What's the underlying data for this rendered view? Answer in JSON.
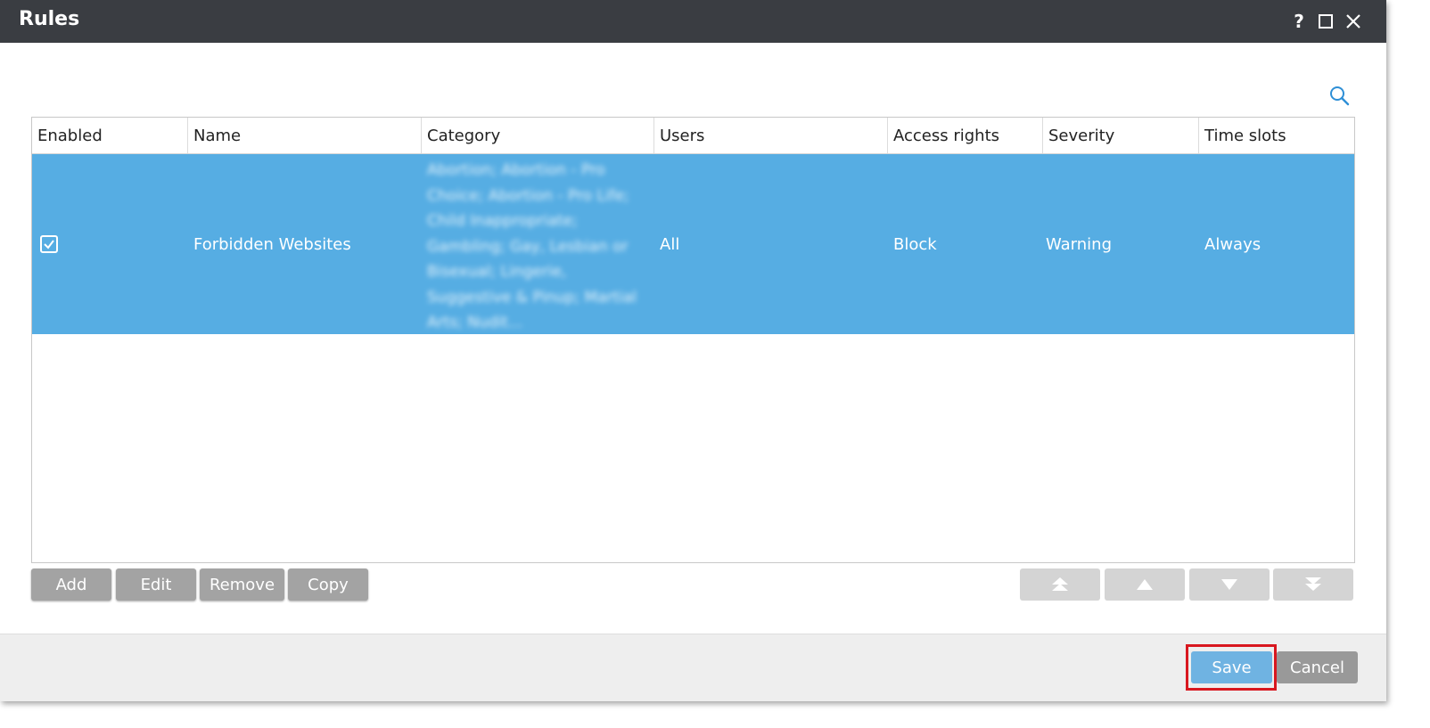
{
  "window": {
    "title": "Rules",
    "help_label": "?"
  },
  "table": {
    "columns": [
      "Enabled",
      "Name",
      "Category",
      "Users",
      "Access rights",
      "Severity",
      "Time slots"
    ],
    "rows": [
      {
        "enabled": true,
        "name": "Forbidden Websites",
        "category": "Abortion; Abortion - Pro Choice; Abortion - Pro Life; Child Inappropriate; Gambling; Gay, Lesbian or Bisexual; Lingerie, Suggestive & Pinup; Martial Arts; Nudit...",
        "users": "All",
        "access_rights": "Block",
        "severity": "Warning",
        "time_slots": "Always"
      }
    ]
  },
  "toolbar": {
    "add_label": "Add",
    "edit_label": "Edit",
    "remove_label": "Remove",
    "copy_label": "Copy"
  },
  "footer": {
    "save_label": "Save",
    "cancel_label": "Cancel"
  },
  "icons": {
    "search": "search-icon",
    "maximize": "maximize-icon",
    "close": "close-icon",
    "move_top": "move-top-icon",
    "move_up": "move-up-icon",
    "move_down": "move-down-icon",
    "move_bottom": "move-bottom-icon"
  },
  "colors": {
    "titlebar": "#3a3d42",
    "selected_row": "#56ade3",
    "save_button": "#6fb3e2",
    "highlight": "#d8171f",
    "search_icon": "#2e8fd6"
  }
}
